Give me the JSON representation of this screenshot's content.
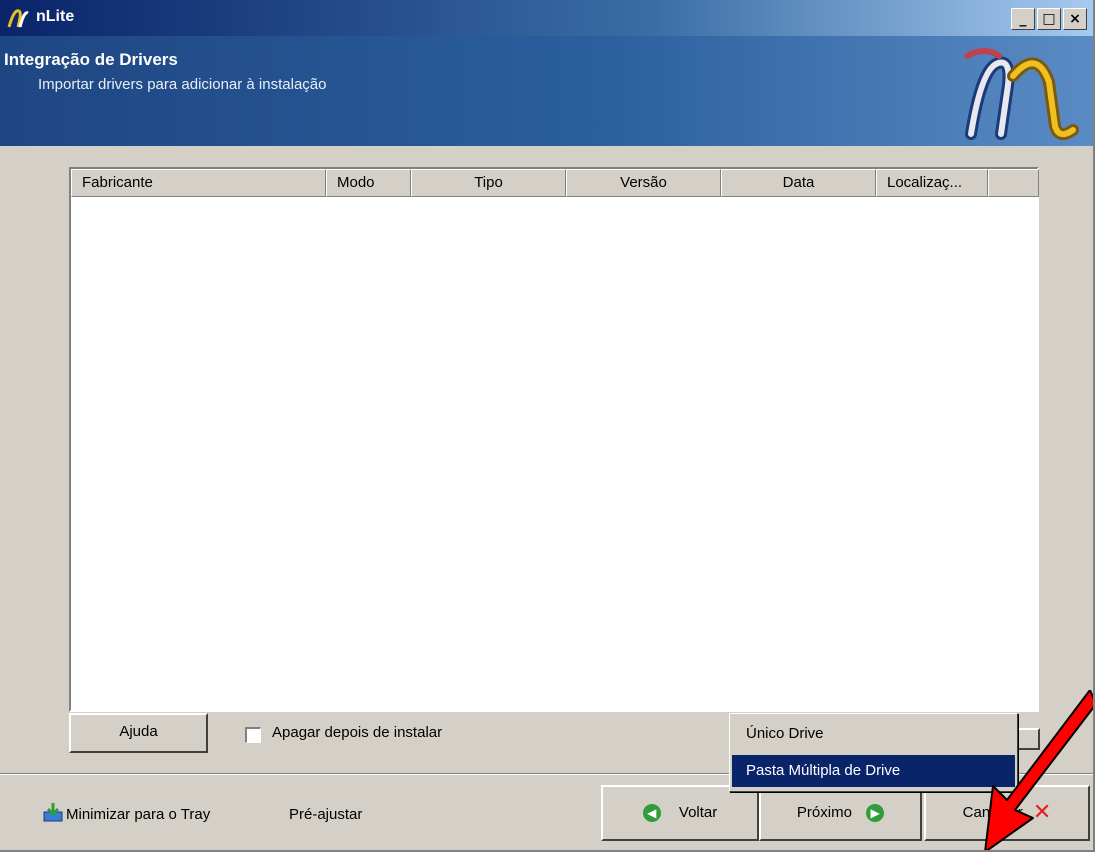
{
  "window": {
    "title": "nLite",
    "controls": {
      "minimize": "_",
      "maximize": "□",
      "close": "×"
    }
  },
  "header": {
    "title": "Integração de Drivers",
    "subtitle": "Importar drivers para adicionar à instalação",
    "logo_icon": "nlite-logo-icon"
  },
  "table": {
    "columns": [
      "Fabricante",
      "Modo",
      "Tipo",
      "Versão",
      "Data",
      "Localizaç..."
    ],
    "rows": []
  },
  "controls": {
    "help_label": "Ajuda",
    "checkbox_label": "Apagar depois de instalar",
    "checkbox_checked": false
  },
  "menu": {
    "items": [
      "Único Drive",
      "Pasta Múltipla de Drive"
    ],
    "selected_index": 1
  },
  "footer": {
    "tray_label": "Minimizar para o Tray",
    "preset_label": "Pré-ajustar",
    "back_label": "Voltar",
    "next_label": "Próximo",
    "cancel_label": "Cancelar"
  },
  "colors": {
    "banner": "#2b5f9e",
    "menu_highlight": "#0a246a",
    "annotation_arrow": "#ff0000",
    "nav_icon": "#2e9d3a",
    "cancel_icon": "#e02020"
  }
}
